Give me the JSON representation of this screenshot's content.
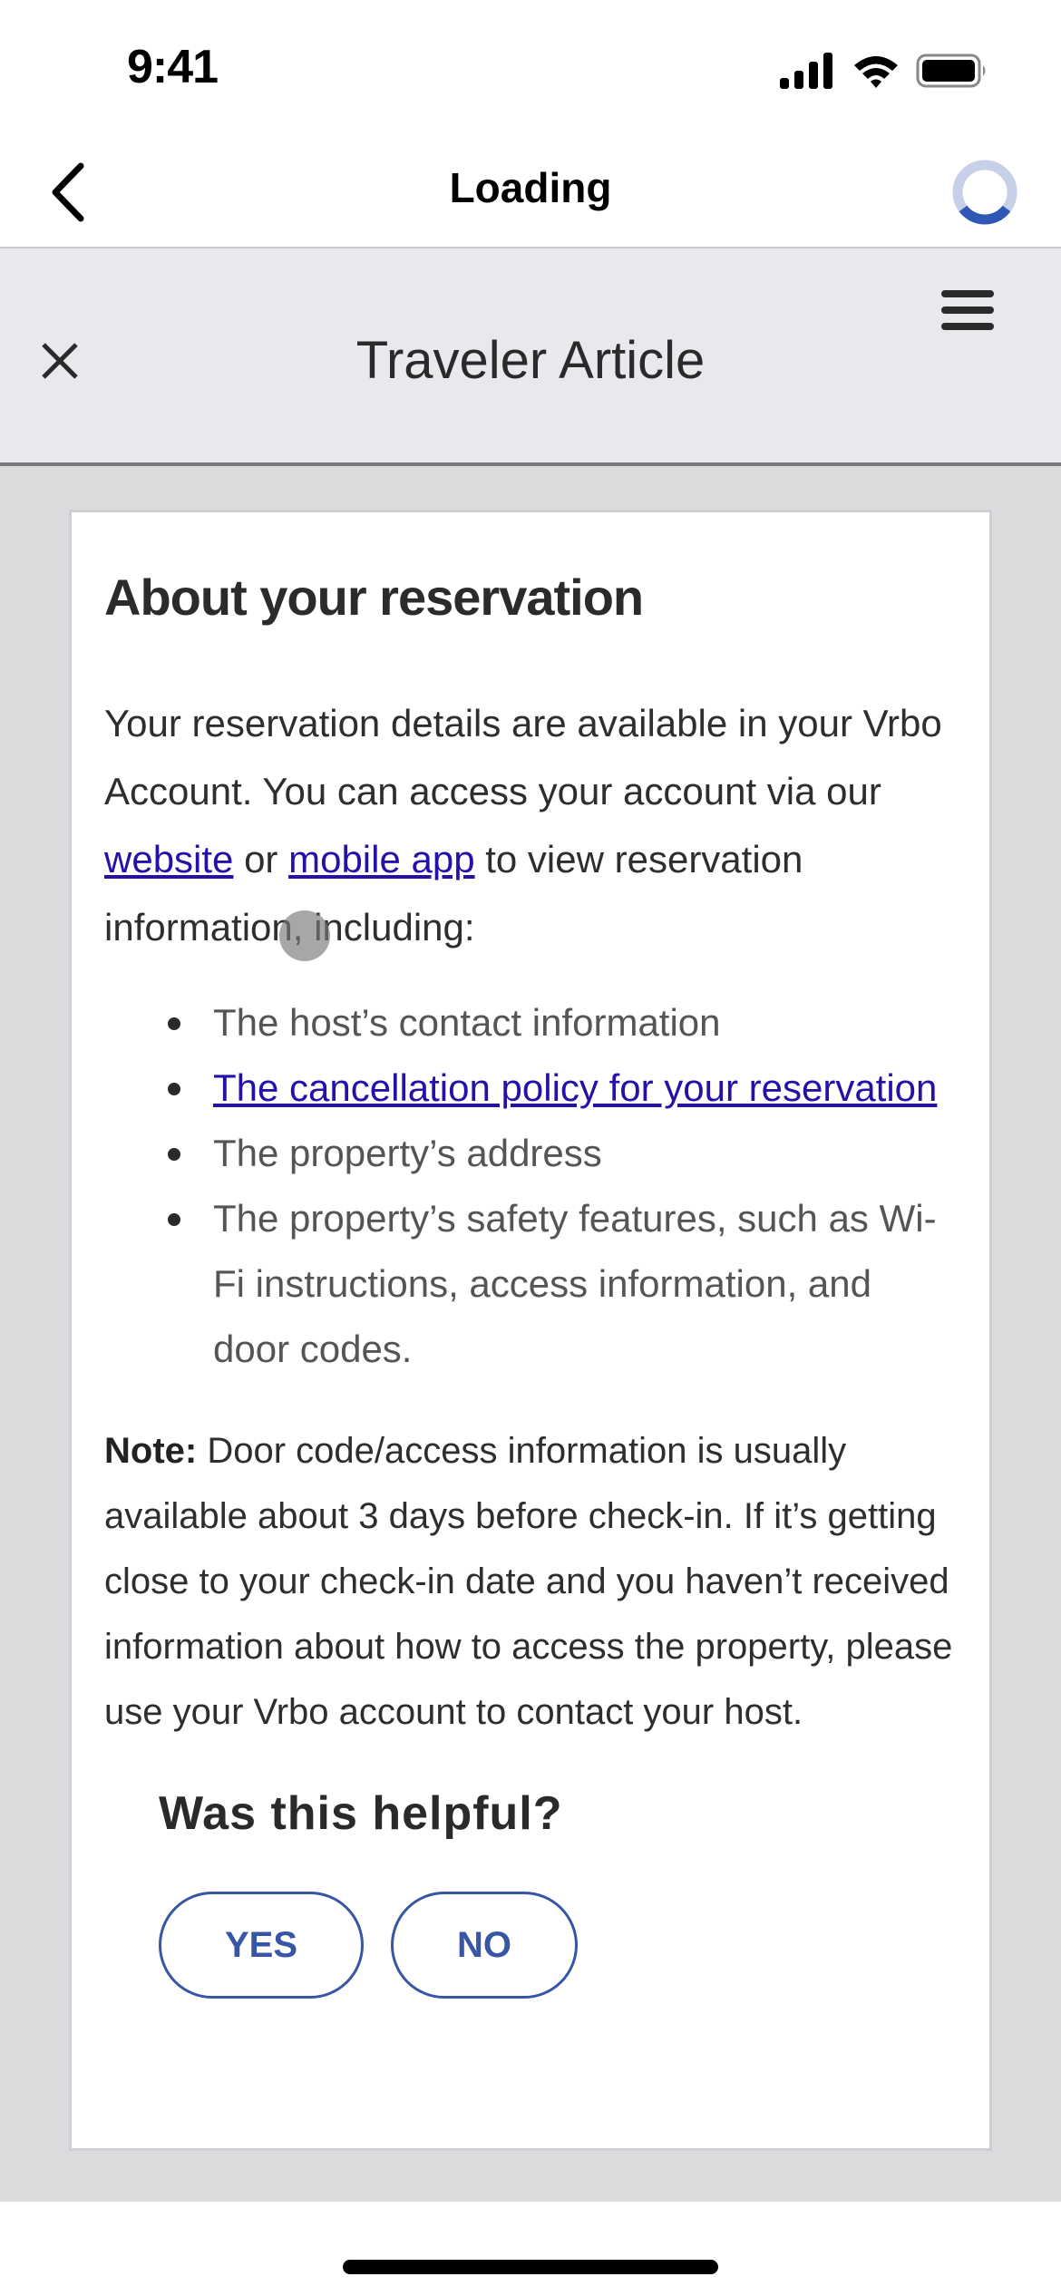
{
  "status_bar": {
    "time": "9:41",
    "icons": [
      "cellular-signal-icon",
      "wifi-icon",
      "battery-icon"
    ]
  },
  "nav_bar": {
    "back_icon": "chevron-left-icon",
    "title": "Loading",
    "spinner": "loading-spinner-icon"
  },
  "article_header": {
    "close_icon": "close-icon",
    "title": "Traveler Article",
    "menu_icon": "hamburger-menu-icon"
  },
  "article": {
    "heading": "About your reservation",
    "intro": {
      "part1": "Your reservation details are available in your Vrbo Account. You can access your account via our ",
      "link1": "website",
      "part2": " or ",
      "link2": "mobile app",
      "part3": " to view reservation information, including:"
    },
    "bullets": [
      {
        "text": "The host’s contact information",
        "is_link": false
      },
      {
        "text": "The cancellation policy for your reservation",
        "is_link": true
      },
      {
        "text": "The property’s address",
        "is_link": false
      },
      {
        "text": "The property’s safety features, such as Wi-Fi instructions, access information, and door codes.",
        "is_link": false
      }
    ],
    "note": {
      "label": "Note:",
      "text": " Door code/access information is usually available about 3 days before check-in. If it’s getting close to your check-in date and you haven’t received information about how to access the property, please use your Vrbo account to contact your host."
    }
  },
  "feedback": {
    "question": "Was this helpful?",
    "yes_label": "YES",
    "no_label": "NO"
  },
  "colors": {
    "accent": "#3756a6",
    "link": "#2311a8",
    "header_bg": "#e8e8ed",
    "content_bg": "#dbdadd"
  }
}
